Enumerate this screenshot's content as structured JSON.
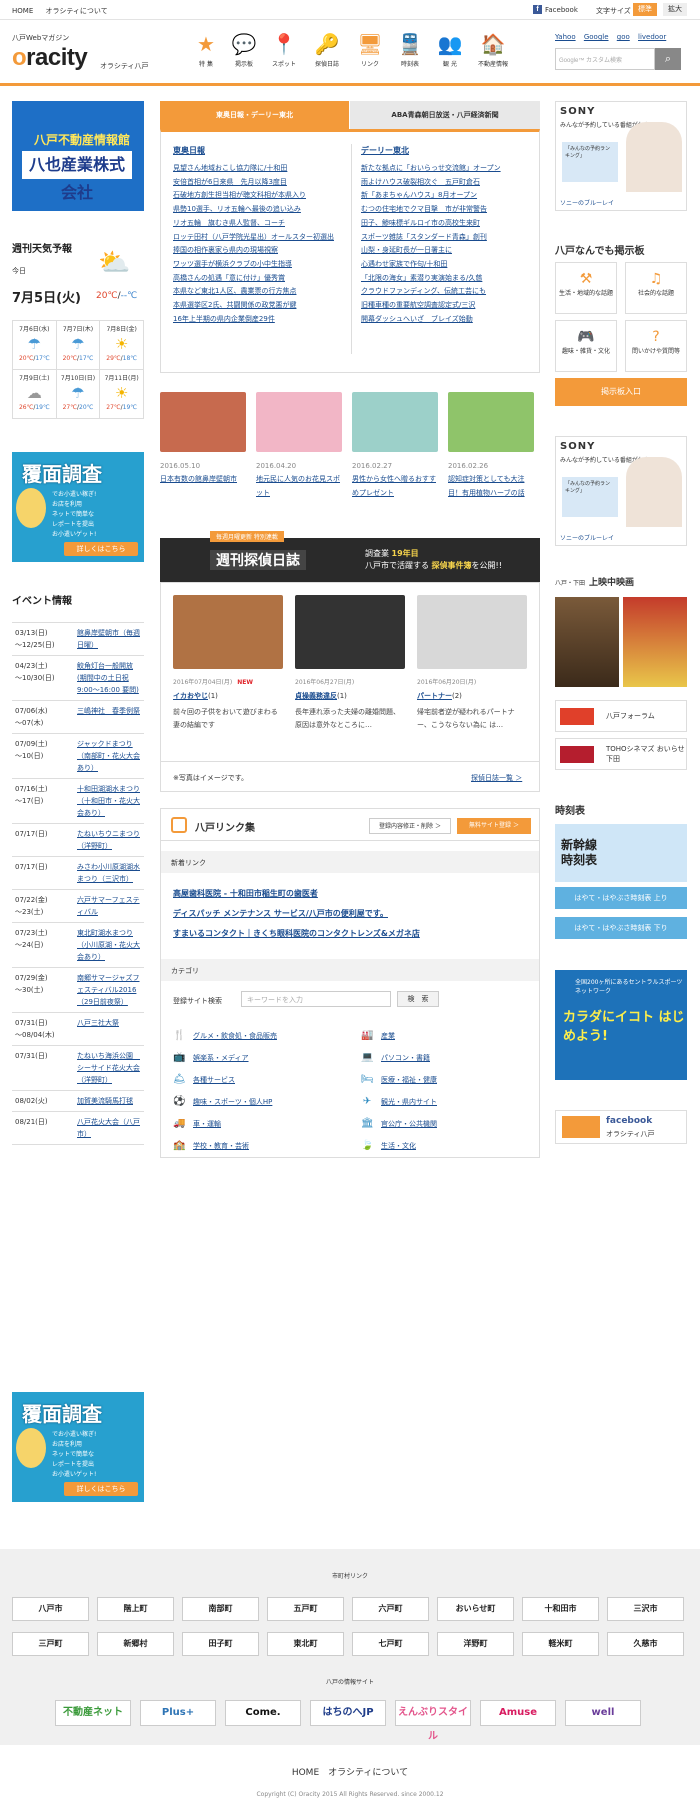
{
  "topbar": {
    "home": "HOME",
    "about": "オラシティについて",
    "facebook": "Facebook",
    "font_size": "文字サイズ",
    "std": "標準",
    "large": "拡大"
  },
  "header": {
    "magazine": "八戸Webマガジン",
    "logo_rest": "racity",
    "logo_o": "o",
    "logo_sub": "オラシティ八戸",
    "nav": [
      {
        "label": "特 集",
        "icon": "star-icon"
      },
      {
        "label": "掲示板",
        "icon": "speech-bubble-icon"
      },
      {
        "label": "スポット",
        "icon": "map-pin-icon"
      },
      {
        "label": "探偵日誌",
        "icon": "key-icon"
      },
      {
        "label": "リンク",
        "icon": "monitor-icon"
      },
      {
        "label": "時刻表",
        "icon": "train-icon"
      },
      {
        "label": "観 光",
        "icon": "tourist-icon"
      },
      {
        "label": "不動産情報",
        "icon": "house-icon"
      }
    ],
    "links": [
      "Yahoo",
      "Google",
      "goo",
      "livedoor"
    ],
    "search_placeholder": "Google™ カスタム検索"
  },
  "left": {
    "ad1": {
      "line1": "八戸不動産情報館",
      "line2": "八也産業株式会社"
    },
    "weather_title": "週刊天気予報",
    "today_label": "今日",
    "today_date": "7月5日(火)",
    "today_hi": "20℃",
    "today_lo": "--℃",
    "week": [
      {
        "day": "7月6日(水)",
        "hi": "20℃",
        "lo": "17℃"
      },
      {
        "day": "7月7日(木)",
        "hi": "20℃",
        "lo": "17℃"
      },
      {
        "day": "7月8日(金)",
        "hi": "29℃",
        "lo": "18℃"
      },
      {
        "day": "7月9日(土)",
        "hi": "26℃",
        "lo": "19℃"
      },
      {
        "day": "7月10日(日)",
        "hi": "27℃",
        "lo": "20℃"
      },
      {
        "day": "7月11日(月)",
        "hi": "27℃",
        "lo": "19℃"
      }
    ],
    "banner": {
      "title": "覆面調査",
      "sub": "でお小遣い稼ぎ!",
      "lines": [
        "お店を利用",
        "ネットで簡単な",
        "レポートを提出",
        "お小遣いゲット!"
      ],
      "btn": "詳しくはこちら"
    },
    "events_title": "イベント情報",
    "events": [
      {
        "date": "03/13(日)\n〜12/25(日)",
        "title": "館鼻岸壁朝市（毎週日曜）"
      },
      {
        "date": "04/23(土)\n〜10/30(日)",
        "title": "鮫角灯台一般開放(期間中の土日祝 9:00〜16:00 要問)"
      },
      {
        "date": "07/06(水)\n〜07(木)",
        "title": "三嶋神社　春季例祭"
      },
      {
        "date": "07/09(土)\n〜10(日)",
        "title": "ジャックドまつり（南部町・花火大会あり）"
      },
      {
        "date": "07/16(土)\n〜17(日)",
        "title": "十和田湖湖水まつり（十和田市・花火大会あり）"
      },
      {
        "date": "07/17(日)",
        "title": "たねいちウニまつり（洋野町）"
      },
      {
        "date": "07/17(日)",
        "title": "みさわ小川原湖湖水まつり（三沢市）"
      },
      {
        "date": "07/22(金)\n〜23(土)",
        "title": "六戸サマーフェスティバル"
      },
      {
        "date": "07/23(土)\n〜24(日)",
        "title": "東北町湖水まつり（小川原湖・花火大会あり）"
      },
      {
        "date": "07/29(金)\n〜30(土)",
        "title": "南郷サマージャズフェスティバル2016（29日前夜祭）"
      },
      {
        "date": "07/31(日)\n〜08/04(木)",
        "title": "八戸三社大祭"
      },
      {
        "date": "07/31(日)",
        "title": "たねいち海浜公園　シーサイド花火大会（洋野町）"
      },
      {
        "date": "08/02(火)",
        "title": "加賀美流騎馬打毬"
      },
      {
        "date": "08/21(日)",
        "title": "八戸花火大会（八戸市）"
      }
    ]
  },
  "center": {
    "tab1": "東奥日報・デーリー東北",
    "tab2": "ABA青森朝日放送・八戸経済新聞",
    "col1_title": "東奥日報",
    "col1": [
      "見望さん地域おこし協力隊に/十和田",
      "安倍首相が6日来県　先月以降3度目",
      "石破地方創生担当相が聴文科相が本県入り",
      "県勢10選手、リオ五輪へ最後の追い込み",
      "リオ五輪　旗むき県人監督、コーチ",
      "ロッテ田村（八戸学院光星出）オールスター初選出",
      "捧国の相作裏家ら県内の現場視察",
      "ワッツ選手が横浜クラブの小中生指導",
      "高橋さんの処遇「意に付け」優秀賞",
      "本県など東北1人区、農業票の行方焦点",
      "本県選挙区2氏、共闘関係の政党悪が鍵",
      "16年上半期の県内企業倒産29件"
    ],
    "col2_title": "デーリー東北",
    "col2": [
      "新たな拠点に「おいらっせ交流館」オープン",
      "雨よけハウス破裂相次ぐ　五戸町倉石",
      "新「あまちゃんハウス」8月オープン",
      "むつの住宅地でクマ目撃　市が非常警告",
      "田子、鯵味標ギルロイ市の高校生来町",
      "スポーツ雑誌「スタンダード青森」創刊",
      "山梨・身延町長が一日署主に",
      "心遇わせ家族で作句/十和田",
      "「北限の海女」素潜り実演始まる/久慈",
      "クラウドファンディング、伝統工芸にも",
      "旧種車種の重要航空調査認定式/三沢",
      "開幕ダッシュへいざ　ブレイズ始動"
    ],
    "photos": [
      {
        "date": "2016.05.10",
        "caption": "日本有数の館鼻岸壁朝市",
        "color": "#c76a4e"
      },
      {
        "date": "2016.04.20",
        "caption": "地元民に人気のお花見スポット",
        "color": "#f2b6c6"
      },
      {
        "date": "2016.02.27",
        "caption": "男性から女性へ贈るおすすめプレゼント",
        "color": "#9cd0c9"
      },
      {
        "date": "2016.02.26",
        "caption": "認知症対策としても大注目！有用植物ハーブの話",
        "color": "#8fc46a"
      }
    ],
    "tantei_tag": "毎週月曜更新 特別連載",
    "tantei_title": "週刊探偵日誌",
    "tantei_right1": "調査業",
    "tantei_right_years": "19年目",
    "tantei_right2": "八戸市で活躍する",
    "tantei_right3": "探偵事件簿",
    "tantei_right4": "を公開!!",
    "tantei": [
      {
        "date": "2016年07月04日(月)",
        "new": "NEW",
        "title": "イカおやじ",
        "num": "(1)",
        "text": "前々回の子供をおいて遊びまわる妻の結編です",
        "color": "#b07244"
      },
      {
        "date": "2016年06月27日(月)",
        "new": "",
        "title": "貞操義務違反",
        "num": "(1)",
        "text": "長年連れ添った夫婦の離婚問題、原因は意外なところに…",
        "color": "#333"
      },
      {
        "date": "2016年06月20日(月)",
        "new": "",
        "title": "パートナー",
        "num": "(2)",
        "text": "帰宅前者逆が疑われるパートナー、こうならない為に は…",
        "color": "#d8d8d8"
      }
    ],
    "tantei_note": "※写真はイメージです。",
    "tantei_more": "探偵日誌一覧 ＞",
    "links_title": "八戸リンク集",
    "links_btn1": "登録内容修正・削除 ＞",
    "links_btn2": "無料サイト登録 ＞",
    "new_links_label": "新着リンク",
    "new_links": [
      "高屋歯科医院 - 十和田市稲生町の歯医者",
      "ディスパッチ メンテナンス サービス/八戸市の便利屋です。",
      "すまいるコンタクト｜きくち眼科医院のコンタクトレンズ&メガネ店"
    ],
    "category_label": "カテゴリ",
    "search_label": "登録サイト検索",
    "search_placeholder": "キーワードを入力",
    "search_btn": "検　索",
    "categories": [
      {
        "label": "グルメ・飲食処・食品販売",
        "icon": "fork-icon"
      },
      {
        "label": "産業",
        "icon": "factory-icon"
      },
      {
        "label": "娯楽系・メディア",
        "icon": "tv-icon"
      },
      {
        "label": "パソコン・書籍",
        "icon": "pc-icon"
      },
      {
        "label": "各種サービス",
        "icon": "service-icon"
      },
      {
        "label": "医療・福祉・健康",
        "icon": "bed-icon"
      },
      {
        "label": "趣味・スポーツ・個人HP",
        "icon": "ball-icon"
      },
      {
        "label": "観光・県内サイト",
        "icon": "plane-icon"
      },
      {
        "label": "車・運輸",
        "icon": "truck-icon"
      },
      {
        "label": "官公庁・公共機関",
        "icon": "building-icon"
      },
      {
        "label": "学校・教育・芸術",
        "icon": "school-icon"
      },
      {
        "label": "生活・文化",
        "icon": "leaf-icon"
      }
    ]
  },
  "right": {
    "sony": {
      "brand": "SONY",
      "copy": "みんなが予約している番組がわかる",
      "card": "「みんなの予約ランキング」",
      "foot": "ソニーのブルーレイ"
    },
    "bbs_title": "八戸なんでも掲示板",
    "bbs": [
      "生活・地域的な話題",
      "社会的な話題",
      "趣味・雑貨・文化",
      "問いかけや質問等"
    ],
    "bbs_btn": "掲示板入口",
    "movie_small": "八戸・下田",
    "movie_title": "上映中映画",
    "theater1": "八戸フォーラム",
    "theater2": "TOHOシネマズ おいらせ下田",
    "timetable_title": "時刻表",
    "timetable_img": "新幹線\n時刻表",
    "tt_btn1": "はやて・はやぶさ時刻表 上り",
    "tt_btn2": "はやて・はやぶさ時刻表 下り",
    "sports_small": "全国200ヶ所にあるセントラルスポーツネットワーク",
    "sports_big": "カラダにイコト はじめよう!",
    "fb_title": "facebook",
    "fb_sub": "オラシティ八戸"
  },
  "footer": {
    "cities_title": "市町村リンク",
    "cities": [
      "八戸市",
      "階上町",
      "南部町",
      "五戸町",
      "六戸町",
      "おいらせ町",
      "十和田市",
      "三沢市",
      "三戸町",
      "新郷村",
      "田子町",
      "東北町",
      "七戸町",
      "洋野町",
      "軽米町",
      "久慈市"
    ],
    "info_title": "八戸の情報サイト",
    "info": [
      "不動産ネット",
      "Plus+",
      "Come.",
      "はちのへJP",
      "えんぶりスタイル",
      "Amuse",
      "well"
    ],
    "nav": "HOME　オラシティについて",
    "copyright": "Copyright (C) Oracity 2015 All Rights Reserved.  since 2000.12"
  }
}
